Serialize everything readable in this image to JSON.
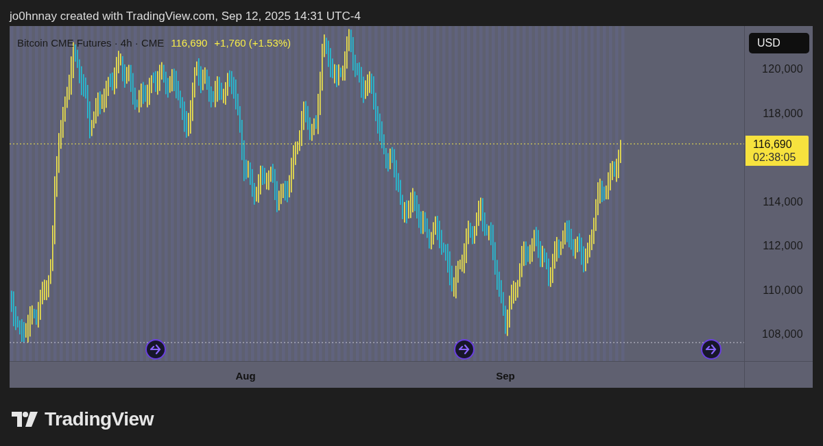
{
  "caption": "jo0hnnay created with TradingView.com, Sep 12, 2025 14:31 UTC-4",
  "legend": {
    "symbol": "Bitcoin CME Futures · 4h · CME",
    "price": "116,690",
    "change": "+1,760 (+1.53%)"
  },
  "price_axis": {
    "currency": "USD",
    "ticks": [
      "120,000",
      "118,000",
      "114,000",
      "112,000",
      "110,000",
      "108,000"
    ],
    "last_price": "116,690",
    "countdown": "02:38:05"
  },
  "time_axis": [
    "Aug",
    "Sep"
  ],
  "brand": "TradingView"
}
